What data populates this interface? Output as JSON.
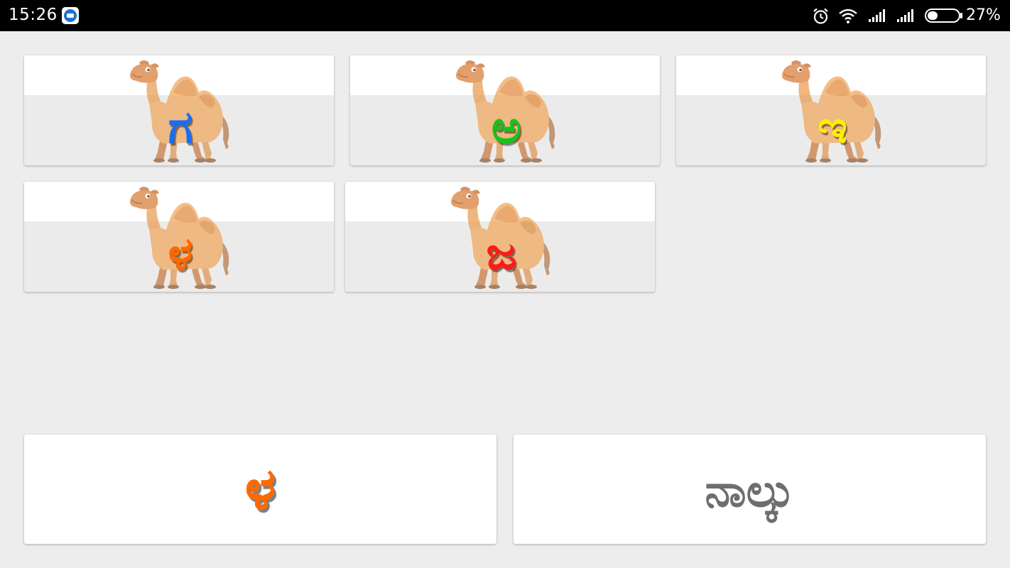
{
  "status_bar": {
    "time": "15:26",
    "notification_icon": "imo-app-icon",
    "icons": [
      "alarm-icon",
      "wifi-icon",
      "signal-icon",
      "signal-icon",
      "battery-icon"
    ],
    "battery_percent": "27%"
  },
  "letter_cards": [
    {
      "letter": "ಗ",
      "color": "#1a6df0",
      "image": "camel-icon"
    },
    {
      "letter": "ಅ",
      "color": "#19c219",
      "image": "camel-icon"
    },
    {
      "letter": "ಇ",
      "color": "#ffee00",
      "image": "camel-icon"
    },
    {
      "letter": "ಳ",
      "color": "#ff6a00",
      "image": "camel-icon"
    },
    {
      "letter": "ಜ",
      "color": "#ff1a1a",
      "image": "camel-icon"
    }
  ],
  "answer": {
    "letter": "ಳ",
    "letter_color": "#ff6a00",
    "word": "ನಾಲ್ಕು",
    "word_color": "#6e6e6e"
  }
}
